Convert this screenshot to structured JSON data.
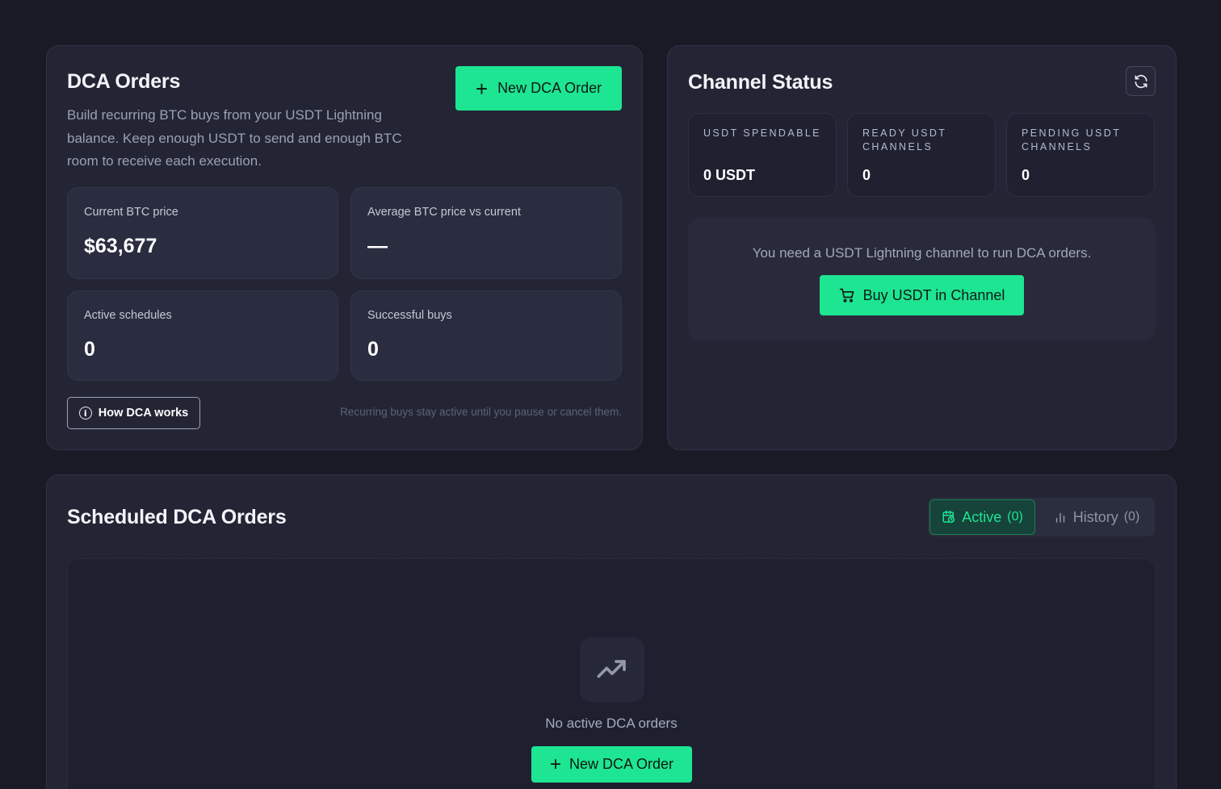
{
  "dca": {
    "title": "DCA Orders",
    "description": "Build recurring BTC buys from your USDT Lightning balance. Keep enough USDT to send and enough BTC room to receive each execution.",
    "new_order_label": "New DCA Order",
    "stats": [
      {
        "label": "Current BTC price",
        "value": "$63,677"
      },
      {
        "label": "Average BTC price vs current",
        "value": "—"
      },
      {
        "label": "Active schedules",
        "value": "0"
      },
      {
        "label": "Successful buys",
        "value": "0"
      }
    ],
    "how_label": "How DCA works",
    "footnote": "Recurring buys stay active until you pause or cancel them."
  },
  "channel": {
    "title": "Channel Status",
    "stats": [
      {
        "label": "USDT SPENDABLE",
        "value": "0 USDT"
      },
      {
        "label": "READY USDT CHANNELS",
        "value": "0"
      },
      {
        "label": "PENDING USDT CHANNELS",
        "value": "0"
      }
    ],
    "need_text": "You need a USDT Lightning channel to run DCA orders.",
    "buy_label": "Buy USDT in Channel"
  },
  "scheduled": {
    "title": "Scheduled DCA Orders",
    "tabs": {
      "active_label": "Active",
      "active_count": "(0)",
      "history_label": "History",
      "history_count": "(0)"
    },
    "empty_text": "No active DCA orders",
    "new_order_label": "New DCA Order"
  },
  "colors": {
    "accent": "#1ee592",
    "background": "#191a26",
    "card": "#232535"
  }
}
